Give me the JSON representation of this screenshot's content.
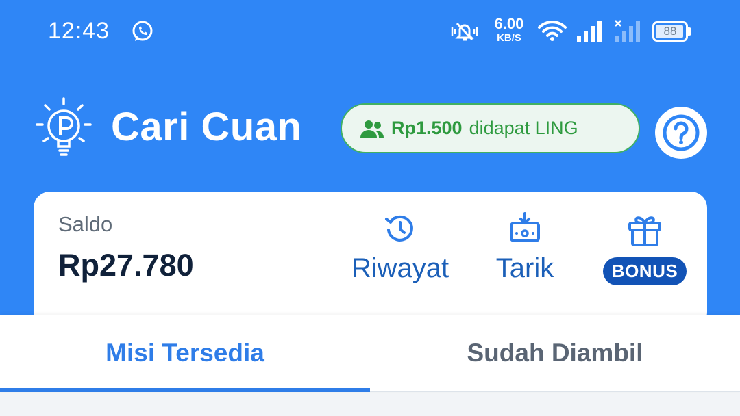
{
  "status_bar": {
    "time": "12:43",
    "net_speed_value": "6.00",
    "net_speed_unit": "KB/S",
    "battery_level": "88"
  },
  "app_bar": {
    "title": "Cari Cuan",
    "referral_amount": "Rp1.500",
    "referral_text": "didapat LING"
  },
  "balance_card": {
    "saldo_label": "Saldo",
    "saldo_value": "Rp27.780",
    "actions": [
      {
        "label": "Riwayat",
        "icon": "history-icon"
      },
      {
        "label": "Tarik",
        "icon": "withdraw-icon"
      },
      {
        "label": "BONUS",
        "icon": "gift-icon"
      }
    ]
  },
  "tabs": [
    {
      "label": "Misi Tersedia",
      "active": true
    },
    {
      "label": "Sudah Diambil",
      "active": false
    }
  ],
  "colors": {
    "header_bg": "#2f86f6",
    "accent_blue": "#2f7de8",
    "action_text": "#1b5fb8",
    "bonus_badge": "#1253b6",
    "referral_green": "#2e9a3f"
  }
}
